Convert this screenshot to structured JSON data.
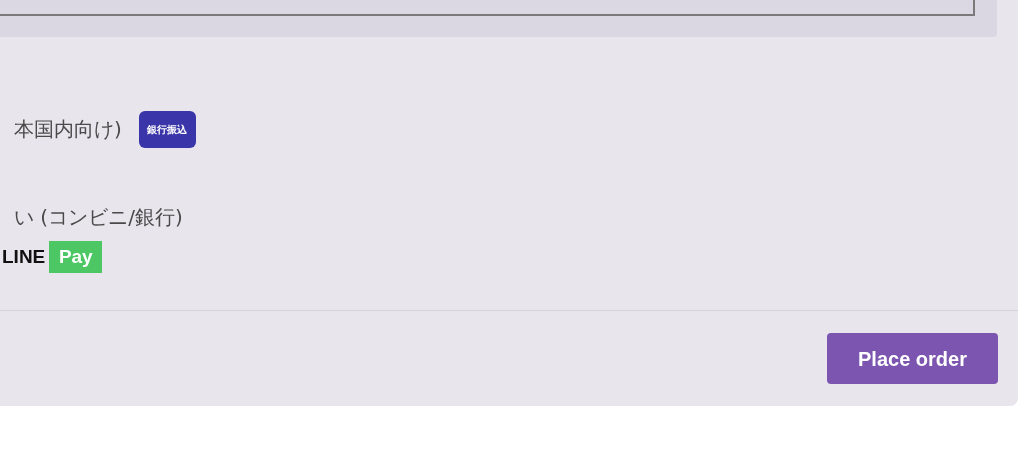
{
  "payment_methods": [
    {
      "label": "本国内向け)",
      "badges": [
        {
          "kind": "bank",
          "text": "銀行振込"
        }
      ]
    },
    {
      "label": "い (コンビニ/銀行)",
      "badges": [
        {
          "kind": "line-word",
          "text": "LINE"
        },
        {
          "kind": "pay-box",
          "text": "Pay"
        }
      ]
    }
  ],
  "place_order_button": "Place order"
}
